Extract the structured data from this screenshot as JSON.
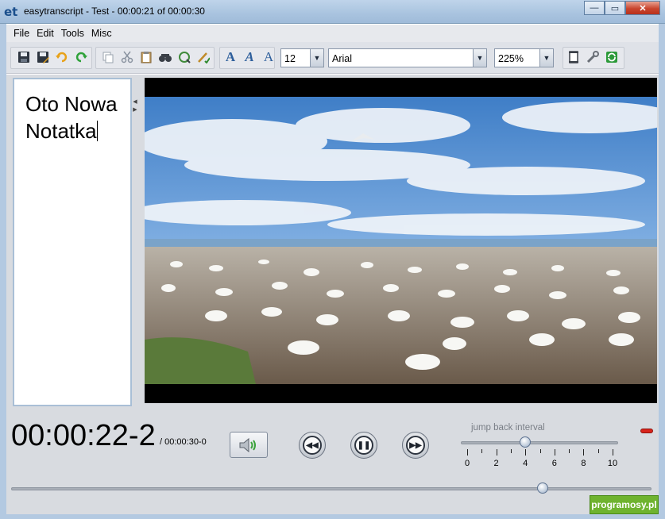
{
  "window": {
    "icon_text": "et",
    "title": "easytranscript - Test - 00:00:21 of 00:00:30",
    "buttons": {
      "minimize": "—",
      "maximize": "▭",
      "close": "✕"
    }
  },
  "menu": [
    "File",
    "Edit",
    "Tools",
    "Misc"
  ],
  "toolbar": {
    "file_icons": [
      "save-icon",
      "save-as-icon",
      "undo-icon",
      "redo-icon"
    ],
    "edit_icons": [
      "copy-icon",
      "cut-icon",
      "paste-icon",
      "find-icon",
      "replace-icon",
      "spellcheck-icon"
    ],
    "font_style_icons": [
      "bold-font-icon",
      "italic-font-icon",
      "plain-font-icon"
    ],
    "font_size": "12",
    "font_family": "Arial",
    "zoom": "225%",
    "extra_icons": [
      "page-icon",
      "settings-wrench-icon",
      "refresh-icon"
    ]
  },
  "editor": {
    "text_line1": "Oto Nowa",
    "text_line2": "Notatka"
  },
  "player": {
    "timecode": "00:00:22-2",
    "duration": "/ 00:00:30-0",
    "position_fraction": 0.83
  },
  "jump_back": {
    "label": "jump back interval",
    "value": 4,
    "min": 0,
    "max": 10,
    "ticks": [
      "0",
      "2",
      "4",
      "6",
      "8",
      "10"
    ]
  },
  "watermark": "programosy.pl",
  "colors": {
    "accent": "#2d5e9b",
    "record_indicator": "#d8241c",
    "watermark_bg": "#6fb32f"
  }
}
